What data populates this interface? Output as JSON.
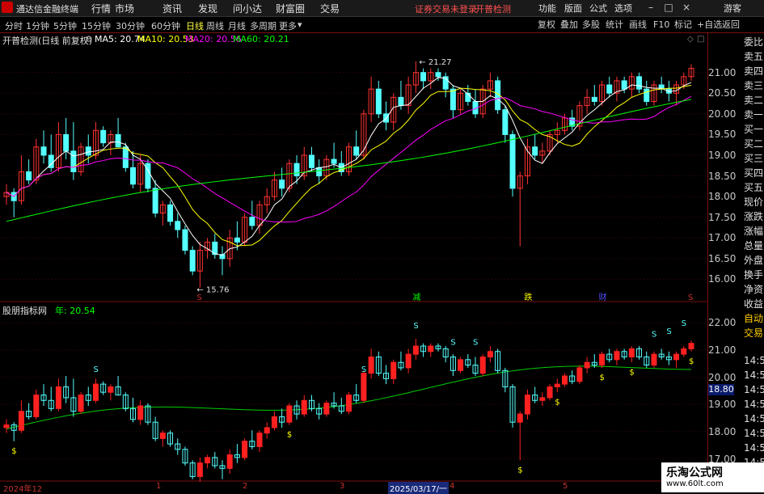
{
  "app": {
    "title": "通达信金融终端"
  },
  "menu": [
    "行情",
    "市场",
    "资讯",
    "发现",
    "问小达",
    "财富圈",
    "交易"
  ],
  "warning": "证券交易未登录",
  "warning2": "开普检测",
  "menu_right": [
    "功能",
    "版面",
    "公式",
    "选项"
  ],
  "guest": "游客",
  "periods": [
    "分时",
    "1分钟",
    "5分钟",
    "15分钟",
    "30分钟",
    "60分钟",
    "日线",
    "周线",
    "月线",
    "多周期",
    "更多"
  ],
  "active_period": "日线",
  "right_tools": [
    "复权",
    "叠加",
    "多股",
    "统计",
    "画线",
    "F10",
    "标记",
    "+自选",
    "返回"
  ],
  "main_header": {
    "name": "开普检测(日线 前复权)",
    "ma5": "MA5: 20.74",
    "ma10": "MA10: 20.53",
    "ma20": "MA20: 20.56",
    "ma60": "MA60: 20.21"
  },
  "colors": {
    "up": "#ff3232",
    "down": "#54ffff",
    "ma5": "#ffffff",
    "ma10": "#ffff00",
    "ma20": "#ff00ff",
    "ma60": "#00ff00",
    "axis": "#c83232"
  },
  "main_ticks": [
    "21.00",
    "20.50",
    "20.00",
    "19.50",
    "19.00",
    "18.50",
    "18.00",
    "17.50",
    "17.00",
    "16.50",
    "16.00"
  ],
  "high_label": "21.27",
  "low_label": "15.76",
  "markers": [
    "S",
    "减",
    "跌",
    "财",
    "S"
  ],
  "side_panel": [
    "委比",
    "卖五",
    "卖四",
    "卖三",
    "卖二",
    "卖一",
    "买一",
    "买二",
    "买三",
    "买四",
    "买五",
    "现价",
    "涨跌",
    "涨幅",
    "总量",
    "外盘",
    "换手",
    "净资",
    "收益",
    "自动",
    "交易"
  ],
  "ind_header": {
    "name": "股朋指标网",
    "value": "年: 20.54"
  },
  "ind_ticks": [
    "22.00",
    "21.00",
    "20.00",
    "19.00",
    "18.00",
    "17.00"
  ],
  "ind_current": "18.80",
  "times": [
    "14:55",
    "14:55",
    "14:55",
    "14:55",
    "14:55",
    "14:55",
    "14:55",
    "14:55"
  ],
  "dates": [
    "2024年12",
    "1",
    "2",
    "3",
    "2025/03/17/一",
    "4",
    "5"
  ],
  "watermark": {
    "line1": "乐淘公式网",
    "line2": "www.60lt.com"
  },
  "chart_data": {
    "type": "candlestick",
    "main": {
      "ylim": [
        15.5,
        21.6
      ],
      "candles": [
        [
          18.0,
          18.3,
          17.8,
          18.1
        ],
        [
          18.1,
          18.2,
          17.5,
          17.9
        ],
        [
          17.9,
          19.0,
          17.8,
          18.6
        ],
        [
          18.6,
          18.9,
          18.3,
          18.4
        ],
        [
          18.4,
          19.4,
          18.3,
          19.2
        ],
        [
          19.2,
          19.6,
          18.8,
          19.0
        ],
        [
          19.0,
          19.5,
          18.6,
          18.7
        ],
        [
          18.7,
          19.8,
          18.6,
          19.5
        ],
        [
          19.5,
          19.9,
          18.9,
          19.1
        ],
        [
          19.1,
          19.8,
          18.4,
          18.6
        ],
        [
          18.6,
          19.3,
          18.5,
          19.2
        ],
        [
          19.2,
          19.5,
          18.8,
          19.0
        ],
        [
          19.0,
          19.8,
          18.9,
          19.6
        ],
        [
          19.6,
          19.7,
          19.2,
          19.3
        ],
        [
          19.3,
          19.6,
          19.0,
          19.5
        ],
        [
          19.5,
          19.9,
          19.2,
          19.2
        ],
        [
          19.2,
          19.3,
          18.6,
          18.7
        ],
        [
          18.7,
          19.1,
          18.2,
          18.3
        ],
        [
          18.3,
          19.0,
          18.1,
          18.8
        ],
        [
          18.8,
          18.9,
          18.1,
          18.2
        ],
        [
          18.2,
          18.4,
          17.5,
          17.6
        ],
        [
          17.6,
          17.9,
          17.3,
          17.8
        ],
        [
          17.8,
          17.9,
          17.3,
          17.4
        ],
        [
          17.4,
          17.6,
          17.0,
          17.2
        ],
        [
          17.2,
          17.3,
          16.6,
          16.7
        ],
        [
          16.7,
          16.8,
          16.1,
          16.2
        ],
        [
          16.2,
          16.9,
          15.8,
          16.7
        ],
        [
          16.7,
          17.0,
          16.5,
          16.9
        ],
        [
          16.9,
          17.1,
          16.5,
          16.6
        ],
        [
          16.6,
          16.8,
          16.1,
          16.5
        ],
        [
          16.5,
          17.2,
          16.3,
          17.0
        ],
        [
          17.0,
          17.4,
          16.7,
          16.9
        ],
        [
          16.9,
          17.6,
          16.8,
          17.5
        ],
        [
          17.5,
          17.9,
          17.2,
          17.3
        ],
        [
          17.3,
          17.9,
          17.1,
          17.8
        ],
        [
          17.8,
          18.2,
          17.6,
          18.0
        ],
        [
          18.0,
          18.6,
          17.9,
          18.4
        ],
        [
          18.4,
          18.7,
          18.0,
          18.2
        ],
        [
          18.2,
          18.9,
          18.1,
          18.8
        ],
        [
          18.8,
          19.0,
          18.3,
          18.5
        ],
        [
          18.5,
          19.2,
          18.4,
          19.0
        ],
        [
          19.0,
          19.2,
          18.6,
          18.7
        ],
        [
          18.7,
          18.9,
          18.3,
          18.5
        ],
        [
          18.5,
          19.0,
          18.4,
          18.9
        ],
        [
          18.9,
          19.3,
          18.7,
          18.8
        ],
        [
          18.8,
          19.1,
          18.5,
          18.6
        ],
        [
          18.6,
          19.3,
          18.5,
          19.2
        ],
        [
          19.2,
          19.6,
          18.9,
          19.0
        ],
        [
          19.0,
          20.1,
          18.9,
          20.0
        ],
        [
          20.0,
          20.9,
          19.8,
          20.6
        ],
        [
          20.6,
          20.8,
          19.9,
          20.0
        ],
        [
          20.0,
          20.3,
          19.6,
          19.8
        ],
        [
          19.8,
          20.5,
          19.6,
          20.4
        ],
        [
          20.4,
          20.8,
          20.1,
          20.2
        ],
        [
          20.2,
          20.9,
          20.0,
          20.7
        ],
        [
          20.7,
          21.27,
          20.5,
          21.0
        ],
        [
          21.0,
          21.1,
          20.6,
          20.8
        ],
        [
          20.8,
          21.1,
          20.6,
          21.0
        ],
        [
          21.0,
          21.1,
          20.8,
          20.9
        ],
        [
          20.9,
          21.0,
          20.4,
          20.6
        ],
        [
          20.6,
          20.7,
          19.9,
          20.1
        ],
        [
          20.1,
          20.6,
          20.0,
          20.5
        ],
        [
          20.5,
          20.7,
          20.2,
          20.3
        ],
        [
          20.3,
          20.6,
          19.9,
          20.0
        ],
        [
          20.0,
          20.7,
          19.9,
          20.6
        ],
        [
          20.6,
          21.0,
          20.4,
          20.8
        ],
        [
          20.8,
          20.9,
          20.0,
          20.1
        ],
        [
          20.1,
          20.2,
          19.3,
          19.5
        ],
        [
          19.5,
          19.6,
          18.0,
          18.2
        ],
        [
          18.2,
          18.6,
          16.8,
          18.5
        ],
        [
          18.5,
          19.4,
          18.3,
          19.2
        ],
        [
          19.2,
          19.5,
          18.9,
          19.0
        ],
        [
          19.0,
          19.3,
          18.8,
          19.1
        ],
        [
          19.1,
          19.6,
          19.0,
          19.5
        ],
        [
          19.5,
          19.8,
          19.3,
          19.6
        ],
        [
          19.6,
          20.0,
          19.5,
          19.9
        ],
        [
          19.9,
          20.1,
          19.6,
          19.7
        ],
        [
          19.7,
          20.3,
          19.6,
          20.2
        ],
        [
          20.2,
          20.6,
          20.0,
          20.4
        ],
        [
          20.4,
          20.7,
          20.2,
          20.3
        ],
        [
          20.3,
          20.8,
          20.2,
          20.7
        ],
        [
          20.7,
          20.9,
          20.4,
          20.5
        ],
        [
          20.5,
          20.9,
          20.3,
          20.8
        ],
        [
          20.8,
          20.9,
          20.5,
          20.6
        ],
        [
          20.6,
          21.0,
          20.4,
          20.9
        ],
        [
          20.9,
          21.0,
          20.5,
          20.6
        ],
        [
          20.6,
          20.8,
          20.2,
          20.3
        ],
        [
          20.3,
          20.8,
          20.2,
          20.7
        ],
        [
          20.7,
          20.9,
          20.5,
          20.6
        ],
        [
          20.6,
          20.8,
          20.3,
          20.5
        ],
        [
          20.5,
          20.8,
          20.2,
          20.7
        ],
        [
          20.7,
          21.0,
          20.6,
          20.9
        ],
        [
          20.9,
          21.2,
          20.8,
          21.1
        ]
      ]
    },
    "indicator": {
      "ylim": [
        16.6,
        22.4
      ],
      "line_start": 18.1,
      "line_end": 20.54
    }
  }
}
